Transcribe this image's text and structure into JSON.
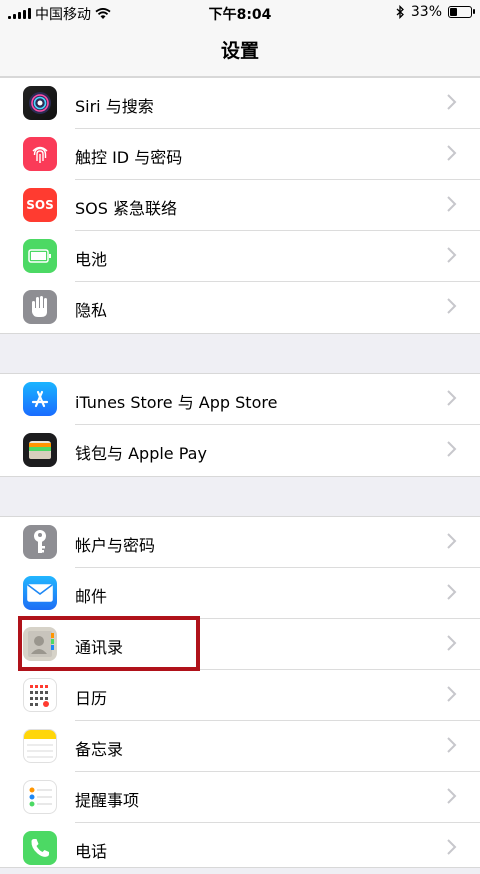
{
  "status_bar": {
    "carrier": "中国移动",
    "time": "下午8:04",
    "battery": "33%",
    "battery_level": 0.33
  },
  "nav": {
    "title": "设置"
  },
  "groups": [
    {
      "items": [
        {
          "label": "Siri 与搜索",
          "icon": "siri-icon",
          "color": "#1a1a2e"
        },
        {
          "label": "触控 ID 与密码",
          "icon": "fingerprint-icon",
          "color": "#fa3b58"
        },
        {
          "label": "SOS 紧急联络",
          "icon": "sos-icon",
          "color": "#ff3b30",
          "icon_text": "SOS"
        },
        {
          "label": "电池",
          "icon": "battery-icon",
          "color": "#4cd964"
        },
        {
          "label": "隐私",
          "icon": "hand-icon",
          "color": "#8e8e93"
        }
      ]
    },
    {
      "items": [
        {
          "label": "iTunes Store 与 App Store",
          "icon": "app-store-icon",
          "color": "#1a8cff"
        },
        {
          "label": "钱包与 Apple Pay",
          "icon": "wallet-icon",
          "color": "#1c1c1e"
        }
      ]
    },
    {
      "items": [
        {
          "label": "帐户与密码",
          "icon": "key-icon",
          "color": "#8e8e93"
        },
        {
          "label": "邮件",
          "icon": "mail-icon",
          "color": "#1e88f5"
        },
        {
          "label": "通讯录",
          "icon": "contacts-icon",
          "color": "#c8c4bc"
        },
        {
          "label": "日历",
          "icon": "calendar-icon",
          "color": "#ffffff"
        },
        {
          "label": "备忘录",
          "icon": "notes-icon",
          "color": "#ffffff"
        },
        {
          "label": "提醒事项",
          "icon": "reminders-icon",
          "color": "#ffffff"
        },
        {
          "label": "电话",
          "icon": "phone-icon",
          "color": "#4cd964"
        }
      ]
    }
  ],
  "highlight_color": "#b0121a"
}
